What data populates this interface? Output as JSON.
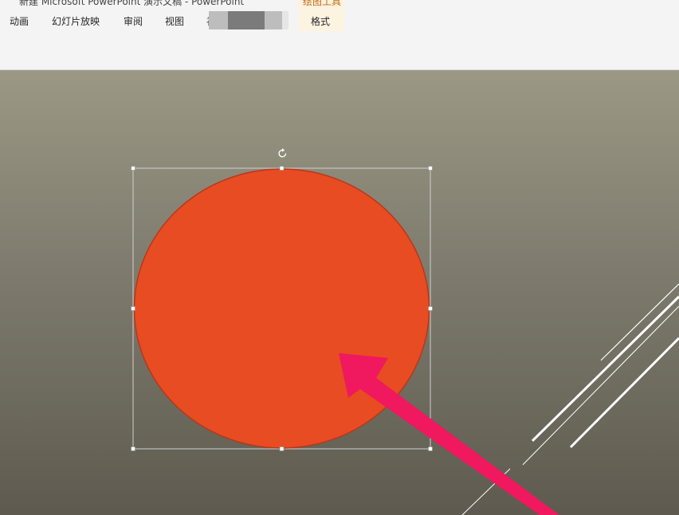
{
  "window": {
    "title": "新建 Microsoft PowerPoint 演示文稿 - PowerPoint"
  },
  "ribbon": {
    "tabs": [
      {
        "label": "动画"
      },
      {
        "label": "幻灯片放映"
      },
      {
        "label": "审阅"
      },
      {
        "label": "视图"
      },
      {
        "label": "福"
      }
    ],
    "contextual_group": {
      "label": "绘图工具",
      "tab": "格式"
    }
  },
  "slide": {
    "shape": {
      "type": "ellipse",
      "selected": true,
      "fill_color": "#e84c22",
      "outline_color": "#b8371a"
    },
    "annotation_arrow_color": "#f0185e",
    "decorative_line_color": "#ffffff"
  }
}
